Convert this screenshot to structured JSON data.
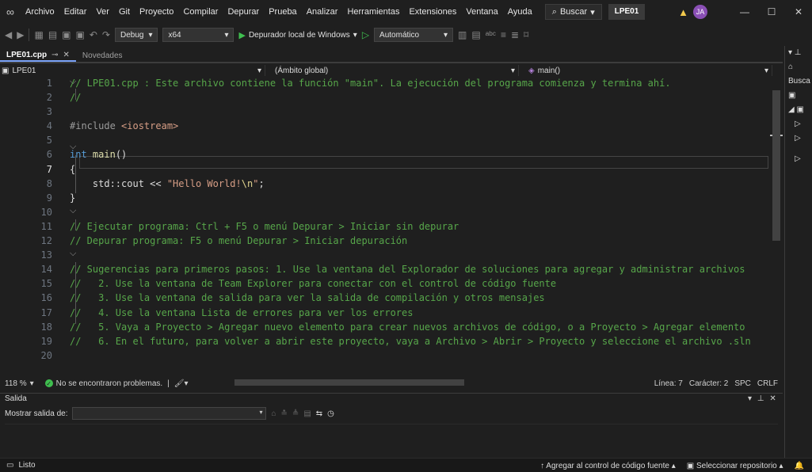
{
  "menu": {
    "items": [
      "Archivo",
      "Editar",
      "Ver",
      "Git",
      "Proyecto",
      "Compilar",
      "Depurar",
      "Prueba",
      "Analizar",
      "Herramientas",
      "Extensiones",
      "Ventana",
      "Ayuda"
    ],
    "search_label": "Buscar",
    "project_name": "LPE01",
    "avatar_initials": "JA"
  },
  "toolbar": {
    "config": "Debug",
    "platform": "x64",
    "run_label": "Depurador local de Windows",
    "run_mode": "Automático"
  },
  "tabs": [
    {
      "label": "LPE01.cpp",
      "active": true
    },
    {
      "label": "Novedades",
      "active": false
    }
  ],
  "navbar": {
    "project": "LPE01",
    "scope": "(Ámbito global)",
    "member": "main()"
  },
  "editor": {
    "lines": [
      {
        "n": "1",
        "segments": [
          {
            "c": "cmt",
            "t": "// LPE01.cpp : Este archivo contiene la función \"main\". La ejecución del programa comienza y termina ahí."
          }
        ]
      },
      {
        "n": "2",
        "segments": [
          {
            "c": "cmt",
            "t": "//"
          }
        ]
      },
      {
        "n": "3",
        "segments": []
      },
      {
        "n": "4",
        "segments": [
          {
            "c": "pp",
            "t": "#include "
          },
          {
            "c": "inc",
            "t": "<iostream>"
          }
        ]
      },
      {
        "n": "5",
        "segments": []
      },
      {
        "n": "6",
        "segments": [
          {
            "c": "kw",
            "t": "int "
          },
          {
            "c": "fn",
            "t": "main"
          },
          {
            "c": "plain",
            "t": "()"
          }
        ]
      },
      {
        "n": "7",
        "segments": [
          {
            "c": "plain",
            "t": "{"
          }
        ]
      },
      {
        "n": "8",
        "segments": [
          {
            "c": "plain",
            "t": "    std::cout << "
          },
          {
            "c": "str",
            "t": "\"Hello World!"
          },
          {
            "c": "esc",
            "t": "\\n"
          },
          {
            "c": "str",
            "t": "\""
          },
          {
            "c": "plain",
            "t": ";"
          }
        ]
      },
      {
        "n": "9",
        "segments": [
          {
            "c": "plain",
            "t": "}"
          }
        ]
      },
      {
        "n": "10",
        "segments": []
      },
      {
        "n": "11",
        "segments": [
          {
            "c": "cmt",
            "t": "// Ejecutar programa: Ctrl + F5 o menú Depurar > Iniciar sin depurar"
          }
        ]
      },
      {
        "n": "12",
        "segments": [
          {
            "c": "cmt",
            "t": "// Depurar programa: F5 o menú Depurar > Iniciar depuración"
          }
        ]
      },
      {
        "n": "13",
        "segments": []
      },
      {
        "n": "14",
        "segments": [
          {
            "c": "cmt",
            "t": "// Sugerencias para primeros pasos: 1. Use la ventana del Explorador de soluciones para agregar y administrar archivos"
          }
        ]
      },
      {
        "n": "15",
        "segments": [
          {
            "c": "cmt",
            "t": "//   2. Use la ventana de Team Explorer para conectar con el control de código fuente"
          }
        ]
      },
      {
        "n": "16",
        "segments": [
          {
            "c": "cmt",
            "t": "//   3. Use la ventana de salida para ver la salida de compilación y otros mensajes"
          }
        ]
      },
      {
        "n": "17",
        "segments": [
          {
            "c": "cmt",
            "t": "//   4. Use la ventana Lista de errores para ver los errores"
          }
        ]
      },
      {
        "n": "18",
        "segments": [
          {
            "c": "cmt",
            "t": "//   5. Vaya a Proyecto > Agregar nuevo elemento para crear nuevos archivos de código, o a Proyecto > Agregar elemento"
          }
        ]
      },
      {
        "n": "19",
        "segments": [
          {
            "c": "cmt",
            "t": "//   6. En el futuro, para volver a abrir este proyecto, vaya a Archivo > Abrir > Proyecto y seleccione el archivo .sln"
          }
        ]
      },
      {
        "n": "20",
        "segments": []
      }
    ],
    "current_line": "7"
  },
  "editor_status": {
    "zoom": "118 %",
    "problems": "No se encontraron problemas.",
    "line": "Línea: 7",
    "col": "Carácter: 2",
    "spc": "SPC",
    "eol": "CRLF"
  },
  "output": {
    "title": "Salida",
    "show_label": "Mostrar salida de:"
  },
  "side": {
    "search_label": "Busca"
  },
  "statusbar": {
    "ready": "Listo",
    "source_control": "Agregar al control de código fuente",
    "repo": "Seleccionar repositorio"
  }
}
